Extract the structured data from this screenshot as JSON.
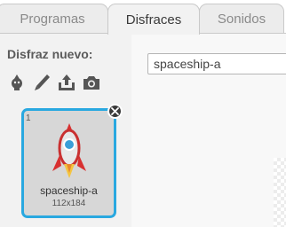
{
  "tabs": [
    {
      "label": "Programas",
      "active": false
    },
    {
      "label": "Disfraces",
      "active": true
    },
    {
      "label": "Sonidos",
      "active": false
    }
  ],
  "sidebar": {
    "title": "Disfraz nuevo:",
    "tools": [
      "paint-new-costume-icon",
      "choose-costume-from-library-icon",
      "upload-costume-icon",
      "camera-icon"
    ]
  },
  "costume": {
    "number": "1",
    "name": "spaceship-a",
    "size": "112x184",
    "selected_border_color": "#29a8e0"
  },
  "editor": {
    "name_value": "spaceship-a"
  }
}
